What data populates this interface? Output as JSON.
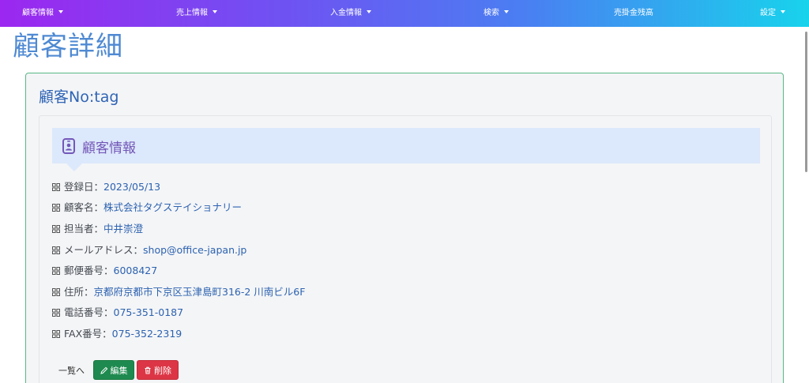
{
  "nav": {
    "items": [
      {
        "label": "顧客情報",
        "dropdown": true
      },
      {
        "label": "売上情報",
        "dropdown": true
      },
      {
        "label": "入金情報",
        "dropdown": true
      },
      {
        "label": "検索",
        "dropdown": true
      },
      {
        "label": "売掛金残高",
        "dropdown": false
      },
      {
        "label": "設定",
        "dropdown": true
      }
    ]
  },
  "page": {
    "title": "顧客詳細"
  },
  "card": {
    "header": "顧客No:tag",
    "section_title": "顧客情報",
    "fields": [
      {
        "label": "登録日：",
        "value": "2023/05/13"
      },
      {
        "label": "顧客名：",
        "value": "株式会社タグステイショナリー"
      },
      {
        "label": "担当者：",
        "value": "中井崇澄"
      },
      {
        "label": "メールアドレス：",
        "value": "shop@office-japan.jp"
      },
      {
        "label": "郵便番号：",
        "value": "6008427"
      },
      {
        "label": "住所：",
        "value": "京都府京都市下京区玉津島町316-2 川南ビル6F"
      },
      {
        "label": "電話番号：",
        "value": "075-351-0187"
      },
      {
        "label": "FAX番号：",
        "value": "075-352-2319"
      }
    ]
  },
  "actions": {
    "back_label": "一覧へ",
    "edit_label": "編集",
    "delete_label": "削除"
  },
  "colors": {
    "nav_gradient_start": "#9c27f0",
    "nav_gradient_end": "#18d3ec",
    "title": "#4f8ad3",
    "card_border": "#59b985",
    "link_value": "#2c62b0",
    "section_bg": "#dce8fb",
    "section_title": "#7357b8",
    "edit_button": "#1f8a4f",
    "delete_button": "#dc3545"
  },
  "icons": {
    "section": "id-badge-icon",
    "field": "grid-icon",
    "edit": "pencil-icon",
    "delete": "trash-icon"
  }
}
